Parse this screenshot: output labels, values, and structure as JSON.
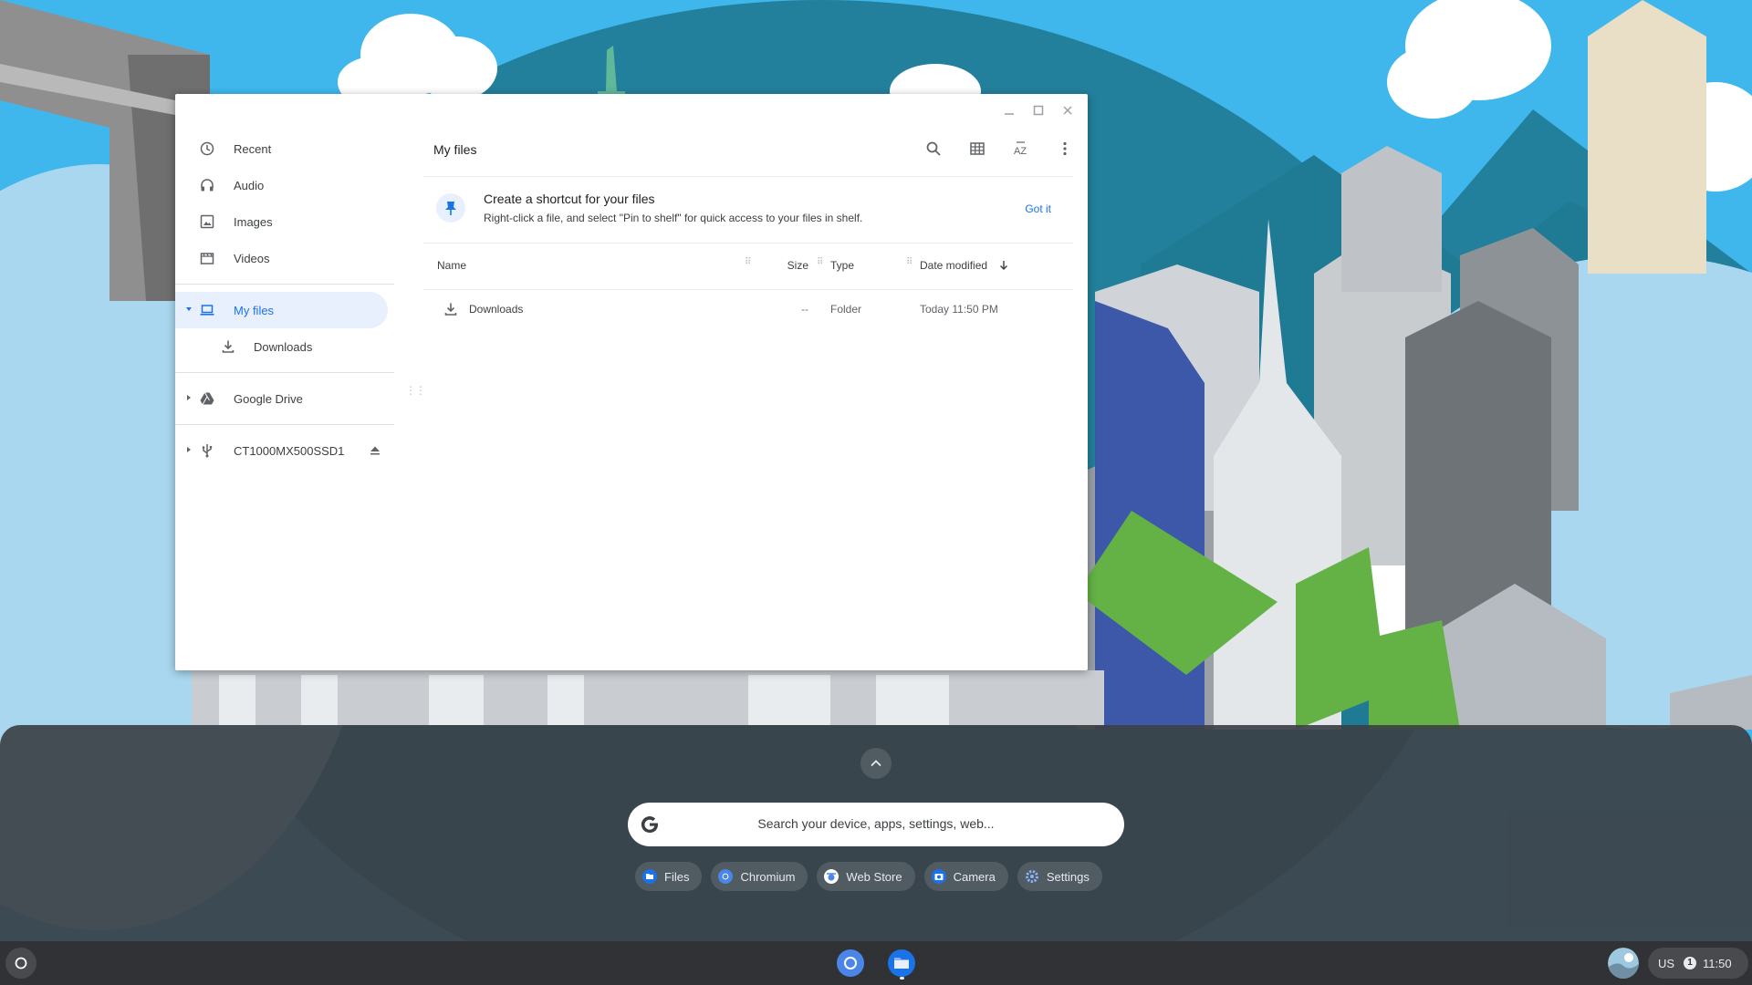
{
  "files": {
    "window_controls": [
      "minimize",
      "maximize",
      "close"
    ],
    "sidebar": {
      "recents": [
        {
          "label": "Recent",
          "icon": "clock-icon"
        },
        {
          "label": "Audio",
          "icon": "headphones-icon"
        },
        {
          "label": "Images",
          "icon": "image-icon"
        },
        {
          "label": "Videos",
          "icon": "video-icon"
        }
      ],
      "my_files": {
        "label": "My files",
        "icon": "laptop-icon",
        "expanded": true,
        "selected": true
      },
      "downloads": {
        "label": "Downloads",
        "icon": "download-icon"
      },
      "google_drive": {
        "label": "Google Drive",
        "icon": "drive-icon"
      },
      "usb": {
        "label": "CT1000MX500SSD1",
        "icon": "usb-icon",
        "eject_icon": "eject-icon"
      }
    },
    "toolbar": {
      "title": "My files",
      "actions": [
        "search-icon",
        "grid-view-icon",
        "sort-az-icon",
        "more-vert-icon"
      ]
    },
    "banner": {
      "title": "Create a shortcut for your files",
      "text": "Right-click a file, and select \"Pin to shelf\" for quick access to your files in shelf.",
      "button": "Got it"
    },
    "columns": {
      "name": "Name",
      "size": "Size",
      "type": "Type",
      "date": "Date modified"
    },
    "rows": [
      {
        "name": "Downloads",
        "size": "--",
        "type": "Folder",
        "date": "Today 11:50 PM",
        "icon": "download-icon"
      }
    ]
  },
  "launcher": {
    "search_placeholder": "Search your device, apps, settings, web...",
    "chips": [
      {
        "label": "Files",
        "icon": "files-icon"
      },
      {
        "label": "Chromium",
        "icon": "chromium-icon"
      },
      {
        "label": "Web Store",
        "icon": "webstore-icon"
      },
      {
        "label": "Camera",
        "icon": "camera-icon"
      },
      {
        "label": "Settings",
        "icon": "settings-icon"
      }
    ]
  },
  "shelf": {
    "apps": [
      "chromium-icon",
      "files-icon"
    ],
    "tray": {
      "ime": "US",
      "notification_count": "1",
      "time": "11:50"
    }
  },
  "colors": {
    "accent": "#1a73e8",
    "sky": "#3fb7ec",
    "launcher_bg": "#3c4046",
    "shelf_bg": "#303235"
  }
}
